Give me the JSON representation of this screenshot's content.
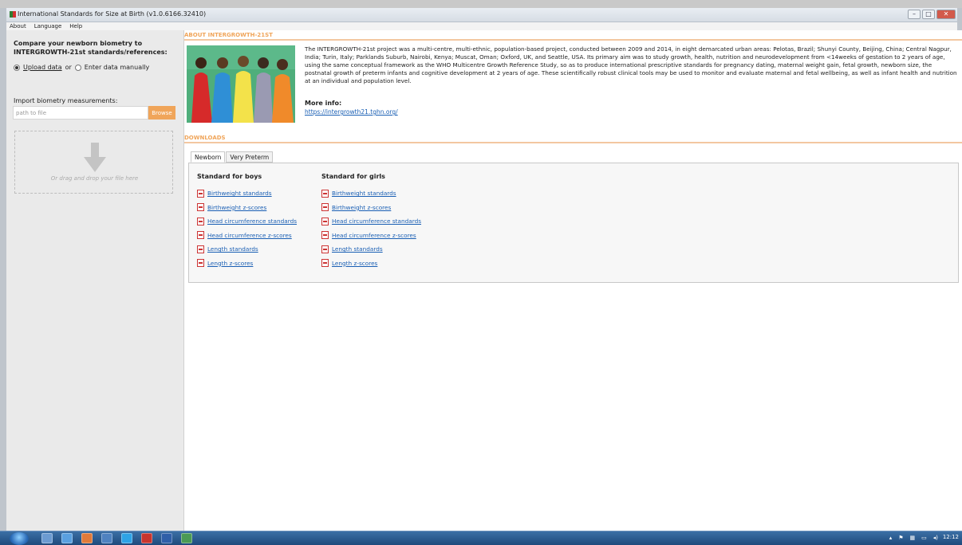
{
  "window": {
    "title": "International Standards for Size at Birth (v1.0.6166.32410)",
    "buttons": {
      "minimize": "–",
      "maximize": "□",
      "close": "✕"
    }
  },
  "menu": [
    "About",
    "Language",
    "Help"
  ],
  "sidebar": {
    "title": "Compare your newborn biometry to INTERGROWTH-21st standards/references:",
    "radio_upload": "Upload data",
    "radio_or": "or",
    "radio_manual": "Enter data manually",
    "import_label": "Import biometry measurements:",
    "path_placeholder": "path to file",
    "browse_label": "Browse",
    "drop_text": "Or drag and drop your file here"
  },
  "about": {
    "header": "ABOUT INTERGROWTH-21st",
    "text": "The INTERGROWTH-21st project was a multi-centre, multi-ethnic, population-based project, conducted between 2009 and 2014, in eight demarcated urban areas: Pelotas, Brazil; Shunyi County, Beijing, China; Central Nagpur, India; Turin, Italy; Parklands Suburb, Nairobi, Kenya; Muscat, Oman; Oxford, UK, and Seattle, USA. Its primary aim was to study growth, health, nutrition and neurodevelopment from <14weeks of gestation to 2 years of age, using the same conceptual framework as the WHO Multicentre Growth Reference Study, so as to produce international prescriptive standards for pregnancy dating, maternal weight gain, fetal growth, newborn size, the postnatal growth of preterm infants and cognitive development at 2 years of age. These scientifically robust clinical tools may be used to monitor and evaluate maternal and fetal wellbeing, as well as infant health and nutrition at an individual and population level.",
    "more_info_label": "More info:",
    "more_info_link": "https://intergrowth21.tghn.org/"
  },
  "downloads": {
    "header": "DOWNLOADS",
    "tabs": [
      "Newborn",
      "Very Preterm"
    ],
    "active_tab": "Newborn",
    "boys_title": "Standard for boys",
    "girls_title": "Standard for girls",
    "boys": [
      "Birthweight standards",
      "Birthweight z-scores",
      "Head circumference standards",
      "Head circumference z-scores",
      "Length standards",
      "Length z-scores"
    ],
    "girls": [
      "Birthweight standards",
      "Birthweight z-scores",
      "Head circumference standards",
      "Head circumference z-scores",
      "Length standards",
      "Length z-scores"
    ]
  },
  "taskbar": {
    "clock": "12:12"
  },
  "colors": {
    "accent": "#f0a55a",
    "link": "#1a5fb4"
  }
}
